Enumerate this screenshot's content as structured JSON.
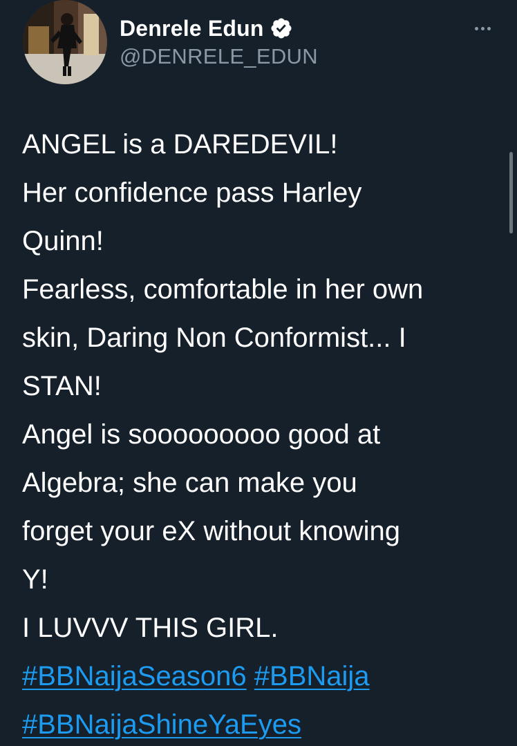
{
  "author": {
    "display_name": "Denrele Edun",
    "handle": "@DENRELE_EDUN",
    "verified": true,
    "avatar_icon": "profile-photo"
  },
  "actions": {
    "more_icon": "more-horizontal-icon"
  },
  "tweet": {
    "lines": [
      "ANGEL is a DAREDEVIL!",
      "Her confidence pass Harley",
      "Quinn!",
      "Fearless, comfortable in her own",
      "skin, Daring Non Conformist... I",
      "STAN!",
      "Angel is sooooooooo good at",
      "Algebra; she can make you",
      "forget your eX without knowing",
      "Y!",
      "I LUVVV THIS GIRL."
    ],
    "hashtags": [
      "#BBNaijaSeason6",
      "#BBNaija",
      "#BBNaijaShineYaEyes"
    ]
  },
  "colors": {
    "background": "#15202b",
    "text": "#ffffff",
    "secondary_text": "#8b98a5",
    "link": "#1d9bf0"
  }
}
